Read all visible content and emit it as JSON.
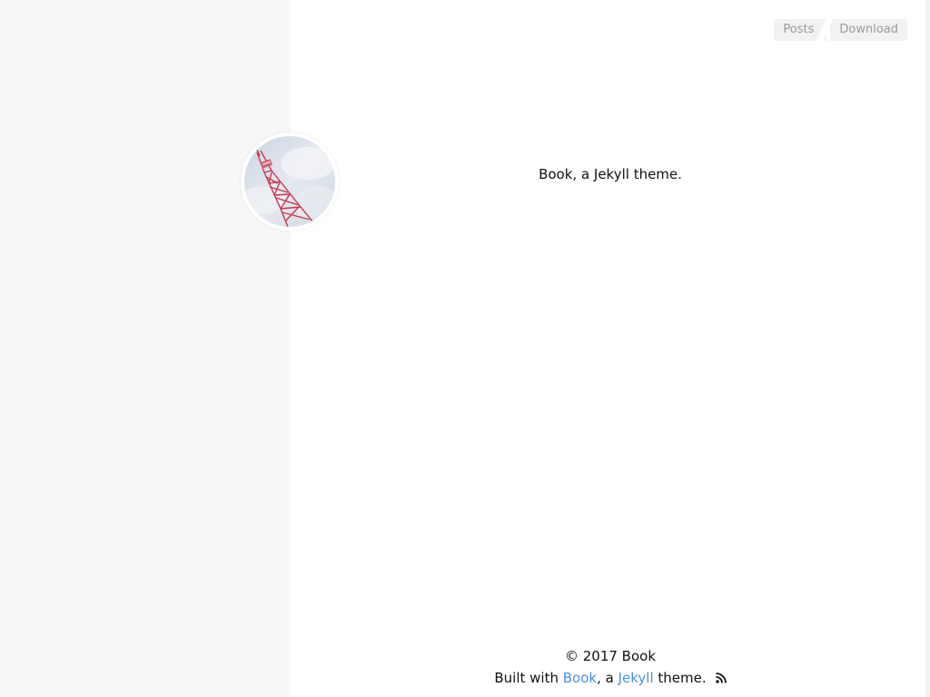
{
  "nav": {
    "items": [
      {
        "label": "Posts"
      },
      {
        "label": "Download"
      }
    ]
  },
  "profile": {
    "avatar_icon": "eiffel-tower-photo",
    "tagline": "Book, a Jekyll theme."
  },
  "footer": {
    "copyright": "© 2017 Book",
    "built_with_prefix": "Built with ",
    "book_link": "Book",
    "middle_text": ", a ",
    "jekyll_link": "Jekyll",
    "suffix_text": " theme.",
    "rss_icon": "rss-icon"
  },
  "colors": {
    "link": "#4a8fe7",
    "sidebar_bg": "#f7f7f7",
    "nav_bg": "#f2f2f2",
    "nav_text": "#9a9a9a"
  }
}
